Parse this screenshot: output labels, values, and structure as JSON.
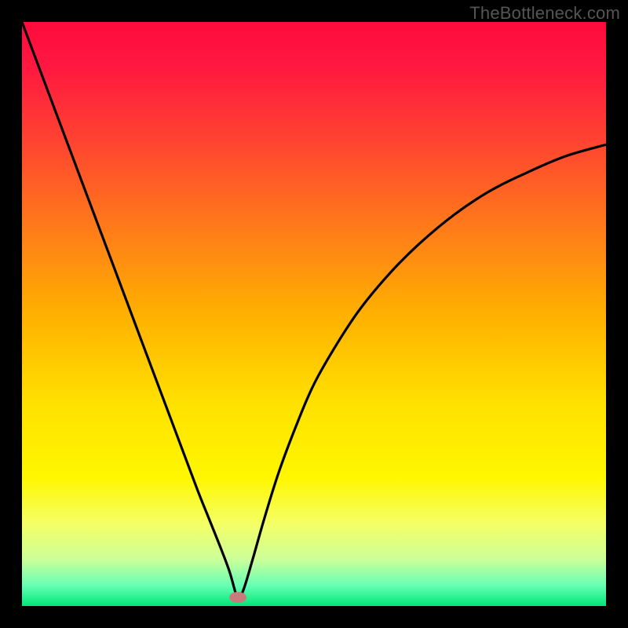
{
  "watermark": {
    "text": "TheBottleneck.com"
  },
  "colors": {
    "gradient_stops": [
      {
        "offset": 0.0,
        "color": "#ff0a3d"
      },
      {
        "offset": 0.08,
        "color": "#ff1940"
      },
      {
        "offset": 0.2,
        "color": "#ff4231"
      },
      {
        "offset": 0.35,
        "color": "#ff7a1a"
      },
      {
        "offset": 0.5,
        "color": "#ffb000"
      },
      {
        "offset": 0.65,
        "color": "#ffe000"
      },
      {
        "offset": 0.78,
        "color": "#fff700"
      },
      {
        "offset": 0.86,
        "color": "#f4ff66"
      },
      {
        "offset": 0.92,
        "color": "#ccff99"
      },
      {
        "offset": 0.965,
        "color": "#66ffb3"
      },
      {
        "offset": 1.0,
        "color": "#00e67a"
      }
    ],
    "curve_stroke": "#000000",
    "marker_fill": "#c97a7a"
  },
  "chart_data": {
    "type": "line",
    "title": "",
    "xlabel": "",
    "ylabel": "",
    "xlim": [
      0,
      1
    ],
    "ylim": [
      0,
      1
    ],
    "grid": false,
    "legend": false,
    "annotations": [],
    "marker": {
      "x": 0.37,
      "y": 0.015
    },
    "series": [
      {
        "name": "bottleneck-curve",
        "x": [
          0.0,
          0.03,
          0.06,
          0.09,
          0.12,
          0.15,
          0.18,
          0.21,
          0.24,
          0.27,
          0.3,
          0.32,
          0.34,
          0.355,
          0.365,
          0.37,
          0.38,
          0.395,
          0.415,
          0.44,
          0.47,
          0.5,
          0.54,
          0.58,
          0.63,
          0.68,
          0.74,
          0.8,
          0.86,
          0.93,
          1.0
        ],
        "y": [
          1.0,
          0.92,
          0.84,
          0.76,
          0.68,
          0.6,
          0.52,
          0.44,
          0.36,
          0.28,
          0.2,
          0.15,
          0.1,
          0.06,
          0.025,
          0.01,
          0.03,
          0.08,
          0.15,
          0.23,
          0.31,
          0.38,
          0.45,
          0.51,
          0.57,
          0.62,
          0.67,
          0.71,
          0.74,
          0.77,
          0.79
        ]
      }
    ]
  }
}
